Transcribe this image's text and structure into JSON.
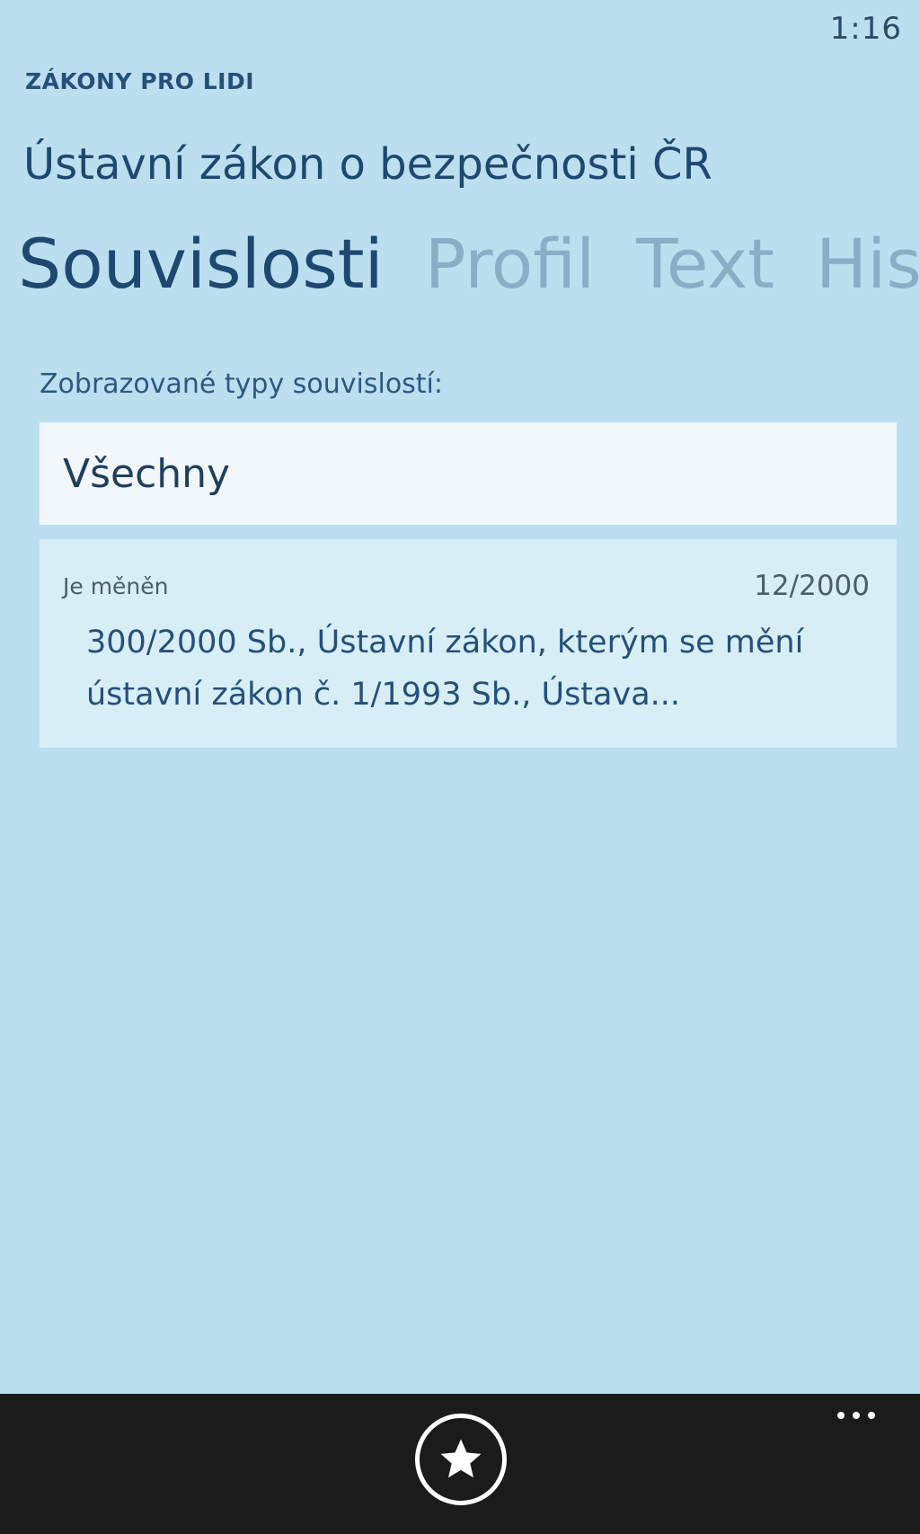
{
  "status": {
    "time": "1:16"
  },
  "header": {
    "app_name": "ZÁKONY PRO LIDI",
    "title": "Ústavní zákon o bezpečnosti ČR"
  },
  "pivot": {
    "tabs": [
      {
        "label": "Souvislosti",
        "active": true
      },
      {
        "label": "Profil",
        "active": false
      },
      {
        "label": "Text",
        "active": false
      },
      {
        "label": "Hist",
        "active": false
      }
    ]
  },
  "filter": {
    "label": "Zobrazované typy souvislostí:",
    "selected": "Všechny"
  },
  "relations": [
    {
      "type": "Je měněn",
      "date": "12/2000",
      "text": "300/2000 Sb., Ústavní zákon, kterým se mění ústavní zákon č. 1/1993 Sb., Ústava..."
    }
  ],
  "app_bar": {
    "primary_icon": "star-icon",
    "more_icon": "ellipsis-icon"
  },
  "colors": {
    "background": "#bcdff0",
    "accent": "#1d4870",
    "inactive": "#8aaec6",
    "app_bar": "#1b1b1b"
  }
}
